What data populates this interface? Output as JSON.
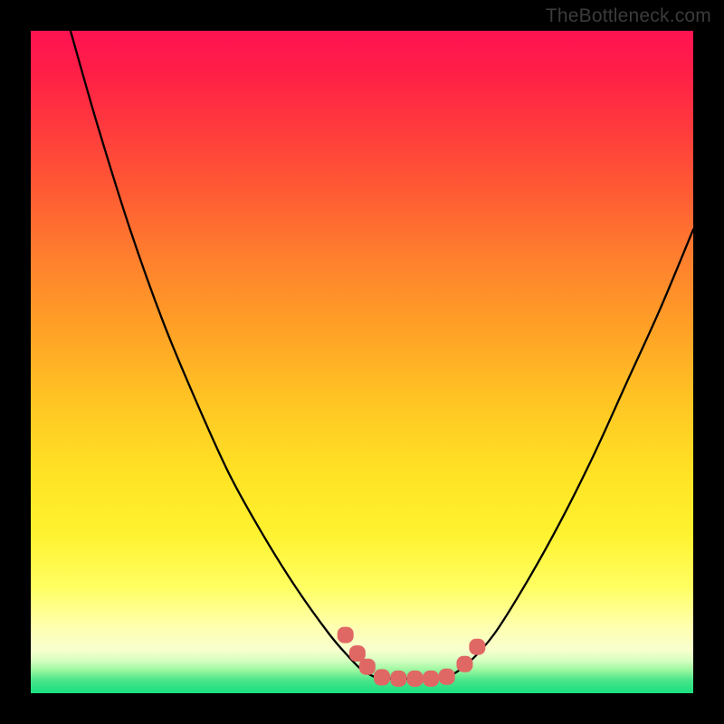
{
  "watermark": "TheBottleneck.com",
  "colors": {
    "frame": "#000000",
    "curve": "#000000",
    "marker_fill": "#e06864",
    "marker_stroke": "#e06864"
  },
  "chart_data": {
    "type": "line",
    "title": "",
    "xlabel": "",
    "ylabel": "",
    "xlim": [
      0,
      100
    ],
    "ylim": [
      0,
      100
    ],
    "note": "Values are estimated by reading curve positions off the raster; y measured as height above the plot-area bottom (percent).",
    "series": [
      {
        "name": "left-curve",
        "x": [
          6,
          10,
          15,
          20,
          25,
          30,
          35,
          40,
          45,
          48,
          50,
          52
        ],
        "y": [
          100,
          86,
          70,
          56,
          44,
          33,
          24,
          16,
          9,
          5.5,
          3.5,
          2.4
        ]
      },
      {
        "name": "right-curve",
        "x": [
          63,
          66,
          70,
          75,
          80,
          85,
          90,
          95,
          100
        ],
        "y": [
          2.4,
          4.5,
          9,
          17,
          26,
          36,
          47,
          58,
          70
        ]
      },
      {
        "name": "bottom-flat",
        "x": [
          52,
          55,
          58,
          60,
          63
        ],
        "y": [
          2.4,
          2.2,
          2.2,
          2.2,
          2.4
        ]
      }
    ],
    "markers": {
      "name": "highlight-blobs",
      "shape": "rounded-rect",
      "approx_size_px": 18,
      "points": [
        {
          "x": 47.5,
          "y": 8.8
        },
        {
          "x": 49.3,
          "y": 6.0
        },
        {
          "x": 50.8,
          "y": 4.0
        },
        {
          "x": 53.0,
          "y": 2.4
        },
        {
          "x": 55.5,
          "y": 2.2
        },
        {
          "x": 58.0,
          "y": 2.2
        },
        {
          "x": 60.4,
          "y": 2.2
        },
        {
          "x": 62.8,
          "y": 2.5
        },
        {
          "x": 65.5,
          "y": 4.4
        },
        {
          "x": 67.4,
          "y": 7.0
        }
      ]
    }
  }
}
